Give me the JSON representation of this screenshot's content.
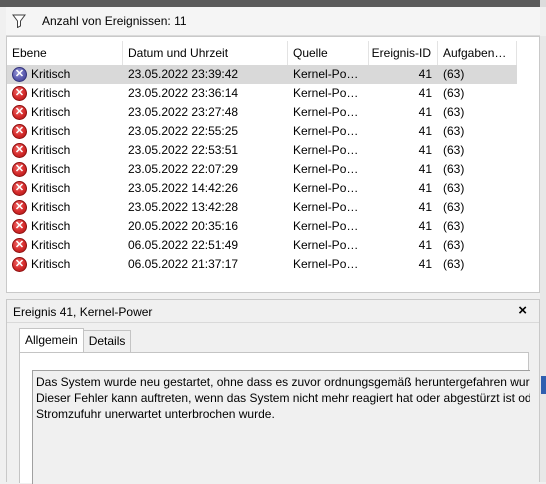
{
  "filter_bar": {
    "icon": "funnel-icon",
    "label": "Anzahl von Ereignissen: 11"
  },
  "table": {
    "columns": [
      "Ebene",
      "Datum und Uhrzeit",
      "Quelle",
      "Ereignis-ID",
      "Aufgaben…"
    ],
    "rows": [
      {
        "ebene": "Kritisch",
        "datum": "23.05.2022 23:39:42",
        "quelle": "Kernel-Po…",
        "id": "41",
        "aufgabe": "(63)",
        "selected": true
      },
      {
        "ebene": "Kritisch",
        "datum": "23.05.2022 23:36:14",
        "quelle": "Kernel-Po…",
        "id": "41",
        "aufgabe": "(63)"
      },
      {
        "ebene": "Kritisch",
        "datum": "23.05.2022 23:27:48",
        "quelle": "Kernel-Po…",
        "id": "41",
        "aufgabe": "(63)"
      },
      {
        "ebene": "Kritisch",
        "datum": "23.05.2022 22:55:25",
        "quelle": "Kernel-Po…",
        "id": "41",
        "aufgabe": "(63)"
      },
      {
        "ebene": "Kritisch",
        "datum": "23.05.2022 22:53:51",
        "quelle": "Kernel-Po…",
        "id": "41",
        "aufgabe": "(63)"
      },
      {
        "ebene": "Kritisch",
        "datum": "23.05.2022 22:07:29",
        "quelle": "Kernel-Po…",
        "id": "41",
        "aufgabe": "(63)"
      },
      {
        "ebene": "Kritisch",
        "datum": "23.05.2022 14:42:26",
        "quelle": "Kernel-Po…",
        "id": "41",
        "aufgabe": "(63)"
      },
      {
        "ebene": "Kritisch",
        "datum": "23.05.2022 13:42:28",
        "quelle": "Kernel-Po…",
        "id": "41",
        "aufgabe": "(63)"
      },
      {
        "ebene": "Kritisch",
        "datum": "20.05.2022 20:35:16",
        "quelle": "Kernel-Po…",
        "id": "41",
        "aufgabe": "(63)"
      },
      {
        "ebene": "Kritisch",
        "datum": "06.05.2022 22:51:49",
        "quelle": "Kernel-Po…",
        "id": "41",
        "aufgabe": "(63)"
      },
      {
        "ebene": "Kritisch",
        "datum": "06.05.2022 21:37:17",
        "quelle": "Kernel-Po…",
        "id": "41",
        "aufgabe": "(63)"
      }
    ]
  },
  "details": {
    "title": "Ereignis 41, Kernel-Power",
    "close": "×",
    "tabs": [
      {
        "label": "Allgemein",
        "active": true
      },
      {
        "label": "Details",
        "active": false
      }
    ],
    "description_lines": [
      "Das System wurde neu gestartet, ohne dass es zuvor ordnungsgemäß heruntergefahren wurd",
      "Dieser Fehler kann auftreten, wenn das System nicht mehr reagiert hat oder abgestürzt ist ode",
      "Stromzufuhr unerwartet unterbrochen wurde."
    ]
  },
  "colors": {
    "error_icon": "#d42a2a",
    "selected_icon": "#5c5cb0",
    "selected_row": "#d9d9d9",
    "accent_mark": "#2f5fb0"
  }
}
